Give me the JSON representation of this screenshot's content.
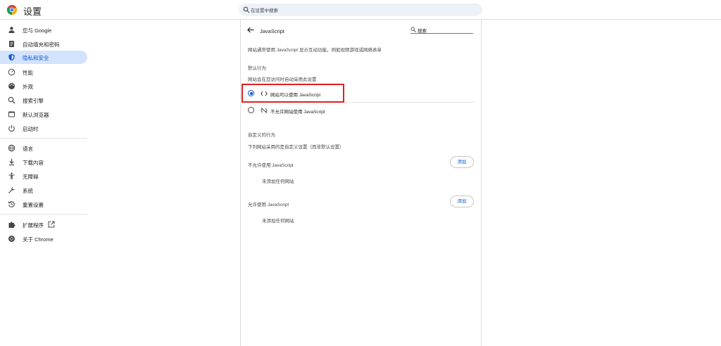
{
  "header": {
    "title": "设置",
    "search_placeholder": "在设置中搜索"
  },
  "sidebar": {
    "items": [
      {
        "label": "您与 Google",
        "icon": "person-icon"
      },
      {
        "label": "自动填充和密码",
        "icon": "clipboard-icon"
      },
      {
        "label": "隐私和安全",
        "icon": "shield-icon",
        "active": true
      },
      {
        "label": "性能",
        "icon": "speedometer-icon"
      },
      {
        "label": "外观",
        "icon": "palette-icon"
      },
      {
        "label": "搜索引擎",
        "icon": "search-icon"
      },
      {
        "label": "默认浏览器",
        "icon": "browser-icon"
      },
      {
        "label": "启动时",
        "icon": "power-icon"
      },
      {
        "label": "语言",
        "icon": "globe-icon"
      },
      {
        "label": "下载内容",
        "icon": "download-icon"
      },
      {
        "label": "无障碍",
        "icon": "accessibility-icon"
      },
      {
        "label": "系统",
        "icon": "wrench-icon"
      },
      {
        "label": "重置设置",
        "icon": "reset-icon"
      },
      {
        "label": "扩展程序",
        "icon": "puzzle-icon"
      },
      {
        "label": "关于 Chrome",
        "icon": "chrome-icon"
      }
    ]
  },
  "panel": {
    "title": "JavaScript",
    "search_label": "搜索",
    "description": "网站通常使用 JavaScript 显示互动功能，例如视频游戏或网络表单",
    "default_behavior": {
      "heading": "默认行为",
      "subheading": "网站会在您访问时自动采用此设置",
      "options": [
        {
          "label": "网站可以使用 JavaScript",
          "icon": "code-icon",
          "checked": true
        },
        {
          "label": "不允许网站使用 JavaScript",
          "icon": "code-off-icon",
          "checked": false
        }
      ]
    },
    "custom_behavior": {
      "heading": "自定义的行为",
      "subheading": "下列网站采用的是自定义设置（而非默认设置）",
      "blocked": {
        "label": "不允许使用 JavaScript",
        "add_label": "添加",
        "empty_text": "未添加任何网站"
      },
      "allowed": {
        "label": "允许使用 JavaScript",
        "add_label": "添加",
        "empty_text": "未添加任何网站"
      }
    }
  },
  "colors": {
    "accent": "#0b57d0",
    "active_nav_bg": "#d3e3fd",
    "highlight_box": "#e02020"
  }
}
